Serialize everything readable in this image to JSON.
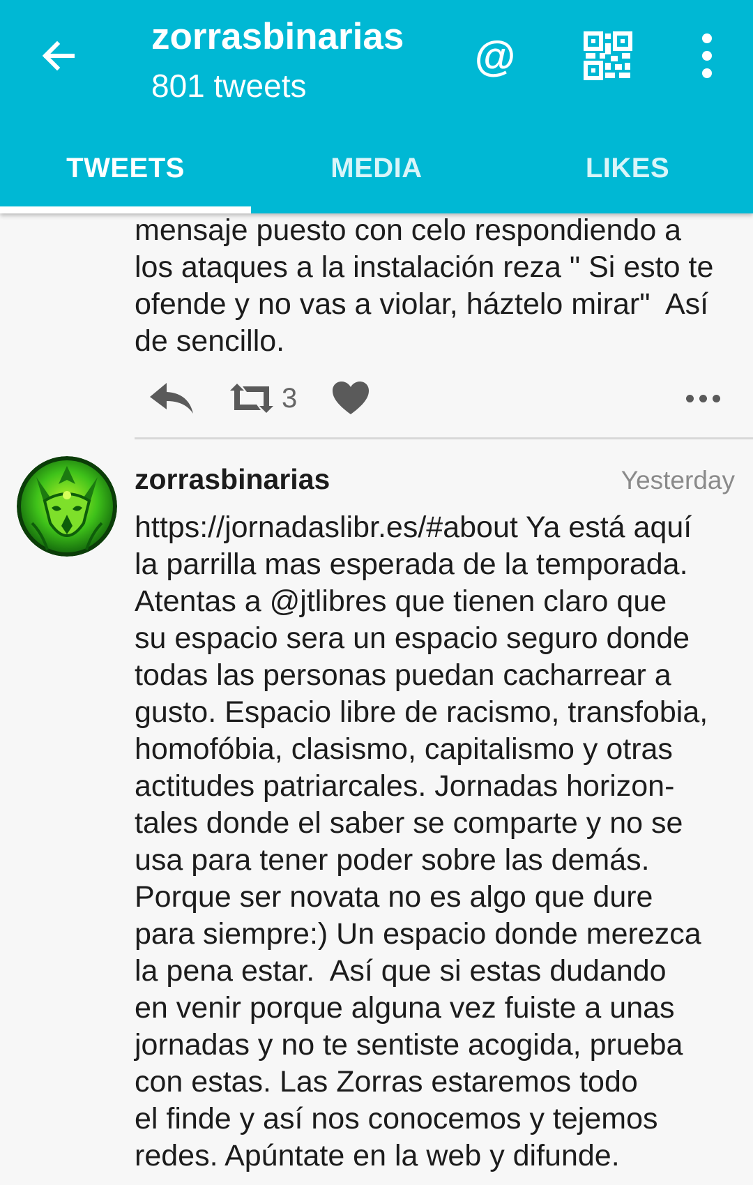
{
  "header": {
    "title": "zorrasbinarias",
    "subtitle": "801 tweets",
    "at_symbol": "@"
  },
  "icons": {
    "back": "arrow-left-icon",
    "mentions": "at-sign-icon",
    "qr": "qr-code-icon",
    "overflow": "more-vertical-icon",
    "reply": "reply-icon",
    "retweet": "retweet-icon",
    "like": "heart-icon",
    "tweet_overflow": "more-horizontal-icon"
  },
  "tabs": [
    {
      "label": "TWEETS",
      "active": true
    },
    {
      "label": "MEDIA",
      "active": false
    },
    {
      "label": "LIKES",
      "active": false
    }
  ],
  "tweets": [
    {
      "text": "mensaje puesto con celo respondiendo a\nlos ataques a la instalación reza \" Si esto te\nofende y no vas a violar, háztelo mirar\"  Así\nde sencillo.",
      "retweets": "3"
    },
    {
      "author": "zorrasbinarias",
      "time": "Yesterday",
      "text": "https://jornadaslibr.es/#about Ya está aquí\nla parrilla mas esperada de la temporada.\nAtentas a @jtlibres que tienen claro que\nsu espacio sera un espacio seguro donde\ntodas las personas puedan cacharrear a\ngusto. Espacio libre de racismo, transfobia,\nhomofóbia, clasismo, capitalismo y otras\nactitudes patriarcales. Jornadas horizon-\ntales donde el saber se comparte y no se\nusa para tener poder sobre las demás.\nPorque ser novata no es algo que dure\npara siempre:) Un espacio donde merezca\nla pena estar.  Así que si estas dudando\nen venir porque alguna vez fuiste a unas\njornadas y no te sentiste acogida, prueba\ncon estas. Las Zorras estaremos todo\nel finde y así nos conocemos y tejemos\nredes. Apúntate en la web y difunde."
    }
  ],
  "colors": {
    "appbar": "#00b8d4",
    "avatar_green": "#3fc21a",
    "text": "#1c1c1c",
    "meta_text": "#8a8a8a"
  }
}
